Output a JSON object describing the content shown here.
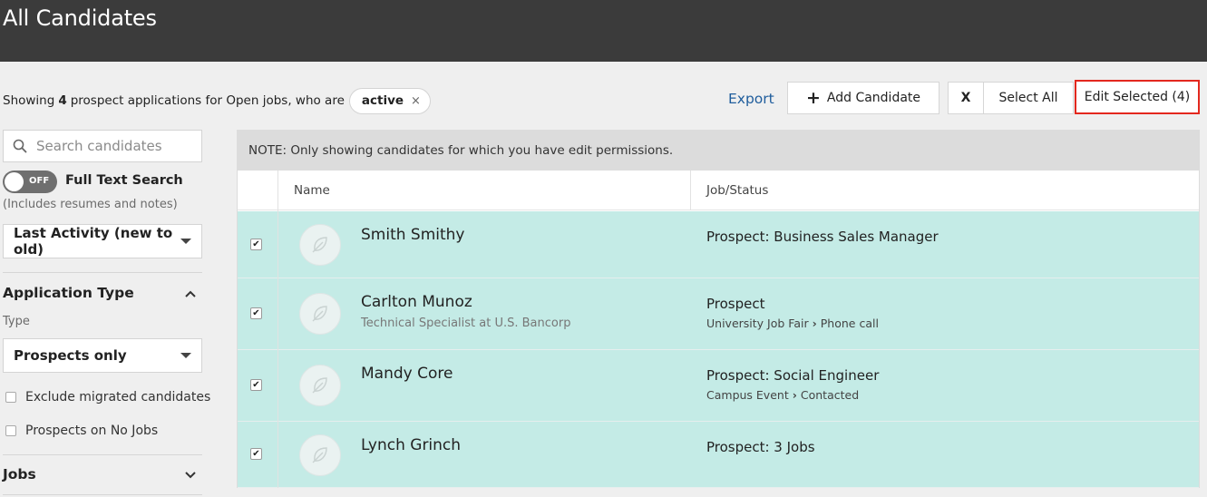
{
  "header": {
    "title": "All Candidates"
  },
  "summary": {
    "prefix": "Showing",
    "count": "4",
    "suffix": "prospect applications for Open jobs, who are",
    "filter_pill": "active",
    "pill_remove": "×"
  },
  "toolbar": {
    "export": "Export",
    "add_candidate": "Add Candidate",
    "clear_selection": "X",
    "select_all": "Select All",
    "edit_selected": "Edit Selected (4)"
  },
  "sidebar": {
    "search_placeholder": "Search candidates",
    "toggle_state": "OFF",
    "full_text_label": "Full Text Search",
    "full_text_note": "(Includes resumes and notes)",
    "sort_value": "Last Activity (new to old)",
    "application_type_heading": "Application Type",
    "type_label": "Type",
    "type_value": "Prospects only",
    "exclude_migrated": "Exclude migrated candidates",
    "prospects_no_jobs": "Prospects on No Jobs",
    "jobs_heading": "Jobs"
  },
  "table": {
    "note": "NOTE: Only showing candidates for which you have edit permissions.",
    "columns": {
      "name": "Name",
      "job_status": "Job/Status"
    },
    "rows": [
      {
        "name": "Smith Smithy",
        "subtitle": "",
        "job": "Prospect: Business Sales Manager",
        "stage_from": "",
        "stage_to": "",
        "checked": "✔"
      },
      {
        "name": "Carlton Munoz",
        "subtitle": "Technical Specialist at U.S. Bancorp",
        "job": "Prospect",
        "stage_from": "University Job Fair",
        "stage_to": "Phone call",
        "checked": "✔"
      },
      {
        "name": "Mandy Core",
        "subtitle": "",
        "job": "Prospect: Social Engineer",
        "stage_from": "Campus Event",
        "stage_to": "Contacted",
        "checked": "✔"
      },
      {
        "name": "Lynch Grinch",
        "subtitle": "",
        "job": "Prospect: 3 Jobs",
        "stage_from": "",
        "stage_to": "",
        "checked": "✔"
      }
    ]
  },
  "colors": {
    "topbar": "#3b3b3b",
    "row_selected": "#c4ebe6",
    "link": "#1f5d9c",
    "highlight": "#e3281e"
  }
}
